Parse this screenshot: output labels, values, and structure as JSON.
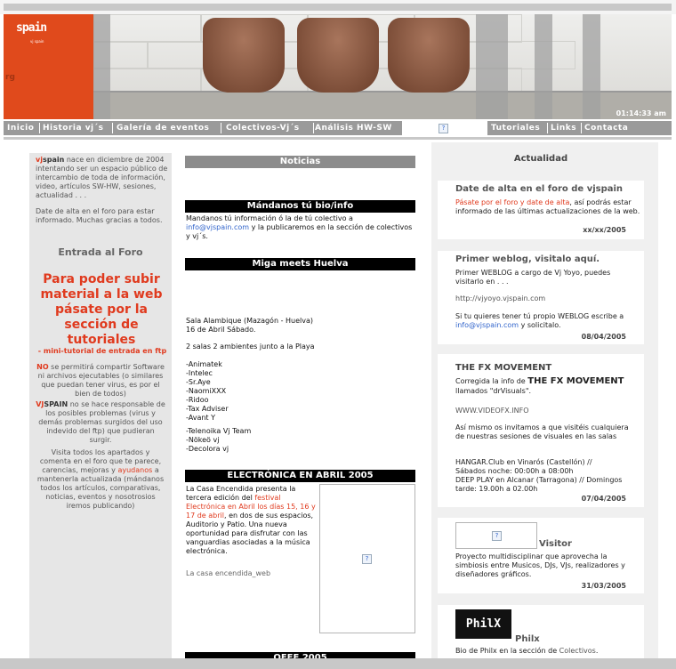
{
  "header": {
    "logo_main": "spain",
    "logo_sub": "vj spain",
    "logo_fragment": "rg",
    "clock": "01:14:33 am"
  },
  "nav": {
    "items": [
      "Inicio",
      "Historia vj´s",
      "Galería de eventos",
      "Colectivos-Vj´s",
      "Análisis  HW-SW",
      "Tutoriales",
      "Links",
      "Contacta"
    ]
  },
  "left": {
    "intro_brand": "vj",
    "intro_brand2": "spain",
    "intro_text": " nace en diciembre de 2004 intentando ser un espacio público de intercambio de toda de información, video, artículos SW-HW, sesiones, actualidad . . .",
    "signup_text": "Date de alta en el foro para estar informado. Muchas gracias a todos.",
    "forum_entry": "Entrada al Foro",
    "upload_notice": "Para poder subir material a la web pásate por la sección de tutoriales",
    "ftp_tutorial": "- mini-tutorial de entrada en ftp",
    "no_word": "NO",
    "no_text": " se permitirá compartir Software ni archivos ejecutables (o similares que puedan tener virus, es por el bien de todos)",
    "vjs_word": "VJ",
    "vjs_word2": "SPAIN",
    "vjs_text": " no se hace responsable de los posibles problemas (virus y demás problemas surgidos del uso indevido del ftp) que pudieran surgir.",
    "visit_text1": "Visita todos los apartados y comenta en el foro que te parece, carencias, mejoras y ",
    "visit_help": "ayudanos",
    "visit_text2": " a mantenerla actualizada (mándanos todos los artículos, comparativas, noticias, eventos y nosotrosios iremos publicando)"
  },
  "middle": {
    "section_title": "Noticias",
    "bio_title": "Mándanos tú bio/info",
    "bio_text1": "Mandanos tú información ó la de tú colectivo a ",
    "bio_email": "info@vjspain.com",
    "bio_text2": " y la publicaremos en la sección de colectivos y vj´s.",
    "miga_title": "Miga meets Huelva",
    "miga_venue": "Sala Alambique (Mazagón - Huelva)",
    "miga_date": "16 de Abril Sábado.",
    "miga_rooms": "2 salas 2 ambientes junto a la Playa",
    "miga_artists": [
      "-Animatek",
      "-Intelec",
      "-Sr.Aye",
      "-NaomiXXX",
      "-Ridoo",
      "-Tax Adviser",
      "-Avant Y"
    ],
    "miga_visuals": [
      "-Telenoika Vj Team",
      "-Nökeö vj",
      "-Decolora vj"
    ],
    "elec_title": "ELECTRÓNICA EN ABRIL 2005",
    "elec_text1": "La Casa Encendida presenta la tercera edición del ",
    "elec_red": "festival Electrónica en Abril los días 15, 16 y 17 de abril",
    "elec_text2": ", en dos de sus espacios, Auditorio y Patio. Una nueva oportunidad para disfrutar con las vanguardias asociadas a la música electrónica.",
    "elec_link": "La casa encendida_web",
    "next_title": "OFFF 2005"
  },
  "right": {
    "section_title": "Actualidad",
    "p1_title": "Date de alta en el foro de vjspain",
    "p1_red": "Pásate por el foro y date de alta",
    "p1_text": ", así podrás estar informado de las últimas actualizaciones de la web.",
    "p1_date": "xx/xx/2005",
    "p2_title": "Primer weblog, visitalo aquí.",
    "p2_text": "Primer WEBLOG a cargo de Vj Yoyo, puedes visitarlo en . . .",
    "p2_url": "http://vjyoyo.vjspain.com",
    "p2_text2a": "Si tu quieres tener tú propio WEBLOG escribe a ",
    "p2_email": "info@vjspain.com",
    "p2_text2b": " y solicitalo.",
    "p2_date": "08/04/2005",
    "p3_title1": "THE FX MOVEMENT",
    "p3_intro": "Corregida la info de ",
    "p3_big": "THE FX MOVEMENT",
    "p3_after": " llamados \"drVisuals\".",
    "p3_url": "WWW.VIDEOFX.INFO",
    "p3_text": "Así mismo os invitamos a que visitéis cualquiera de nuestras sesiones de visuales en las salas",
    "p3_hangar": "HANGAR.Club en Vinarós (Castellón) // Sábados noche: 00:00h a 08:00h",
    "p3_deep": "DEEP PLAY en Alcanar (Tarragona) // Domingos tarde: 19.00h a 02.00h",
    "p3_date": "07/04/2005",
    "p4_title": "Visitor",
    "p4_text": "Proyecto multidisciplinar que aprovecha la simbiosis entre Musicos, DJs, VJs, realizadores y diseñadores gráficos.",
    "p4_date": "31/03/2005",
    "p5_logo": "PhilX",
    "p5_title": "Philx",
    "p5_text": "Bio de Philx en la sección de ",
    "p5_link": "Colectivos",
    "p5_dot": "."
  }
}
